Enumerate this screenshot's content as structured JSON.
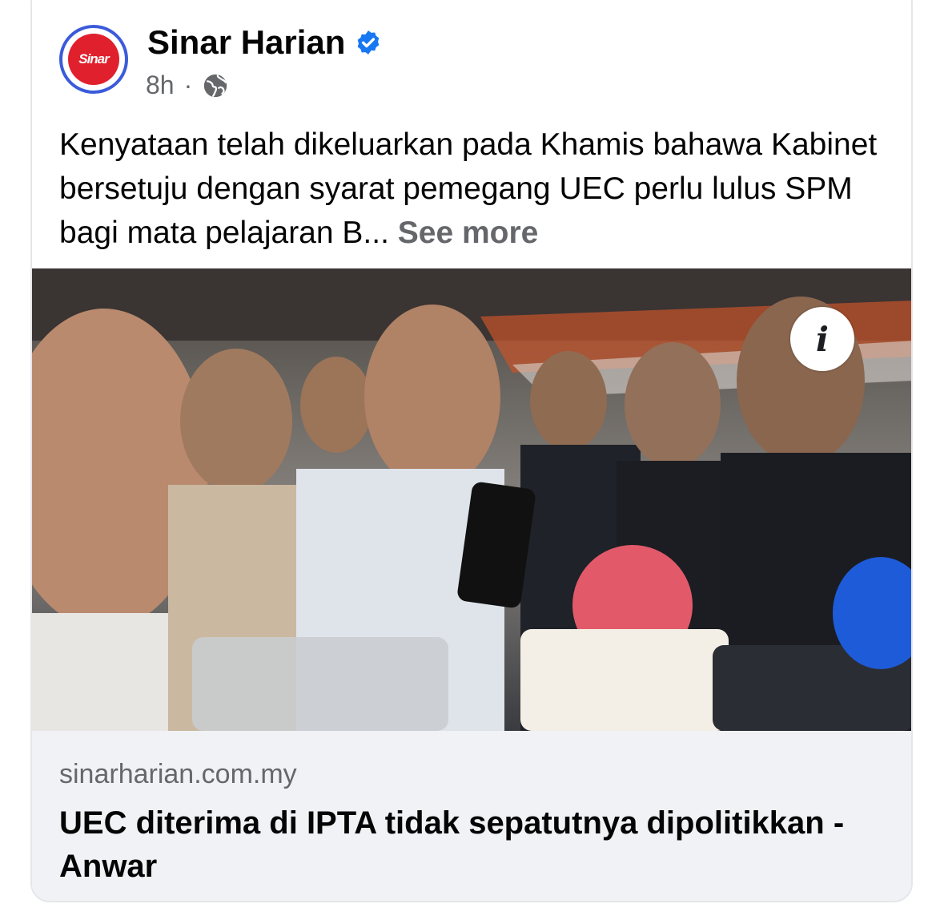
{
  "post": {
    "page_name": "Sinar Harian",
    "avatar_text": "Sinar",
    "time": "8h",
    "separator": "·",
    "text": "Kenyataan telah dikeluarkan pada Khamis bahawa Kabinet bersetuju dengan syarat pemegang UEC perlu lulus SPM bagi mata pelajaran B...",
    "see_more": "See more",
    "info_label": "i"
  },
  "link": {
    "domain": "sinarharian.com.my",
    "headline": "UEC diterima di IPTA tidak sepatutnya dipolitikkan - Anwar"
  },
  "colors": {
    "brand_red": "#e0202c",
    "verified_blue": "#1877f2",
    "footer_bg": "#f0f2f5"
  },
  "icons": {
    "verified": "verified-badge-icon",
    "audience": "globe-icon",
    "info": "info-icon"
  }
}
